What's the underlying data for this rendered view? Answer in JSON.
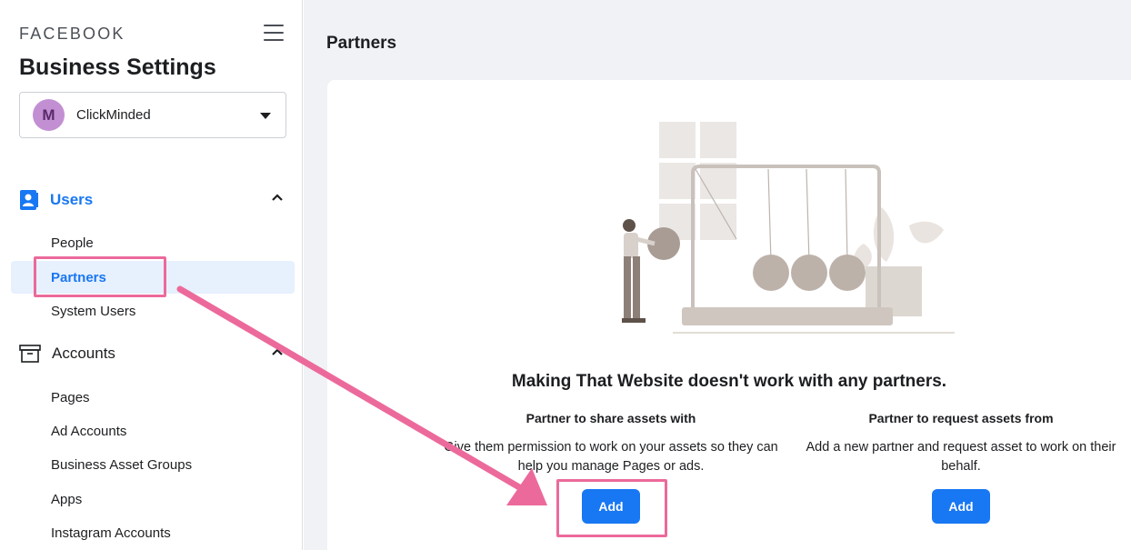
{
  "sidebar": {
    "brand": "FACEBOOK",
    "title": "Business Settings",
    "account": {
      "initial": "M",
      "name": "ClickMinded"
    },
    "sections": [
      {
        "label": "Users",
        "icon": "users-icon",
        "items": [
          "People",
          "Partners",
          "System Users"
        ]
      },
      {
        "label": "Accounts",
        "icon": "accounts-icon",
        "items": [
          "Pages",
          "Ad Accounts",
          "Business Asset Groups",
          "Apps",
          "Instagram Accounts"
        ]
      }
    ],
    "active_item": "Partners"
  },
  "main": {
    "page_title": "Partners",
    "empty_state_title": "Making That Website doesn't work with any partners.",
    "share": {
      "heading": "Partner to share assets with",
      "description": "Give them permission to work on your assets so they can help you manage Pages or ads.",
      "button_label": "Add"
    },
    "request": {
      "heading": "Partner to request assets from",
      "description": "Add a new partner and request asset to work on their behalf.",
      "button_label": "Add"
    }
  },
  "colors": {
    "accent": "#1877f2",
    "annotation": "#ec6a9b",
    "avatar": "#c38fd3",
    "background": "#f0f2f5"
  }
}
